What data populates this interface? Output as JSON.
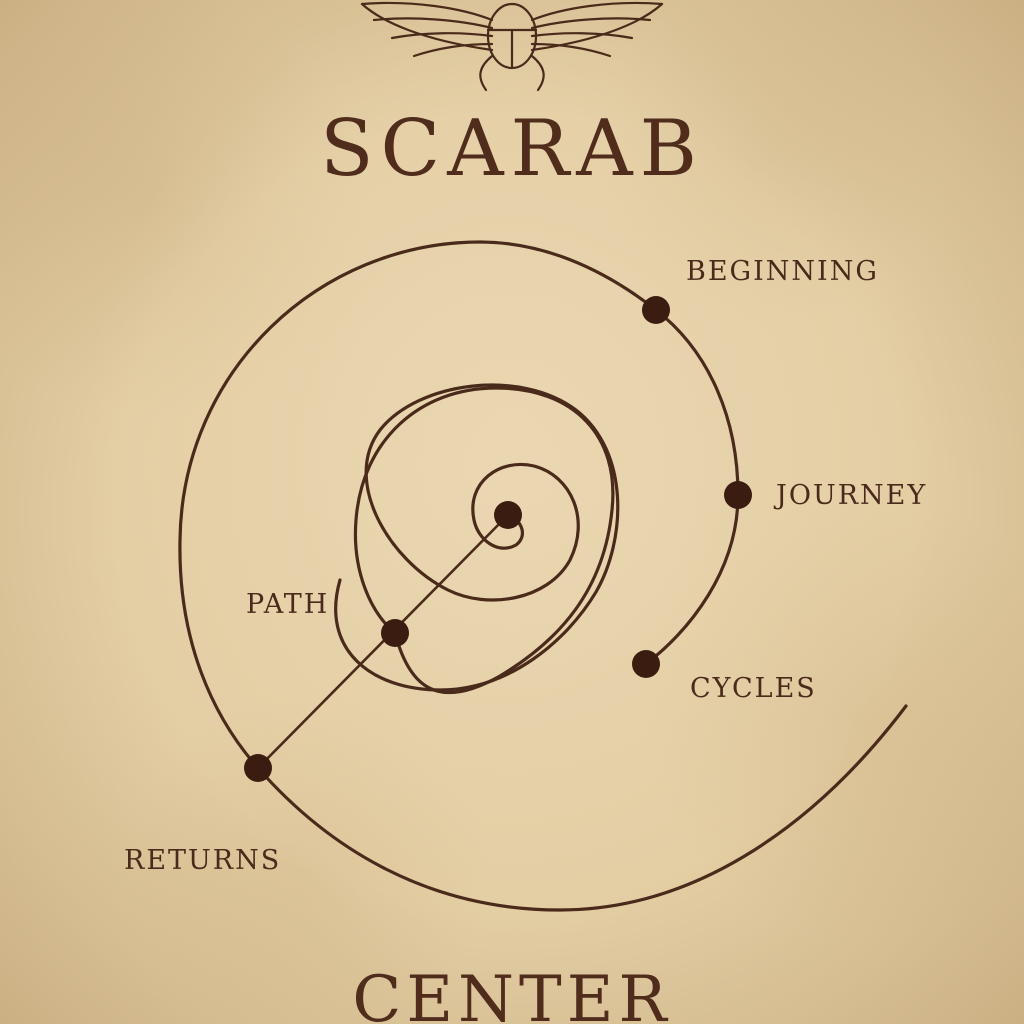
{
  "title": "SCARAB",
  "footer": "CENTER",
  "labels": {
    "beginning": "BEGINNING",
    "journey": "JOURNEY",
    "cycles": "CYCLES",
    "path": "PATH",
    "returns": "RETURNS"
  },
  "icons": {
    "header": "winged-scarab-icon"
  },
  "colors": {
    "ink": "#4a2a1a",
    "dot": "#3a1d10",
    "parchment": "#e3cda3"
  }
}
